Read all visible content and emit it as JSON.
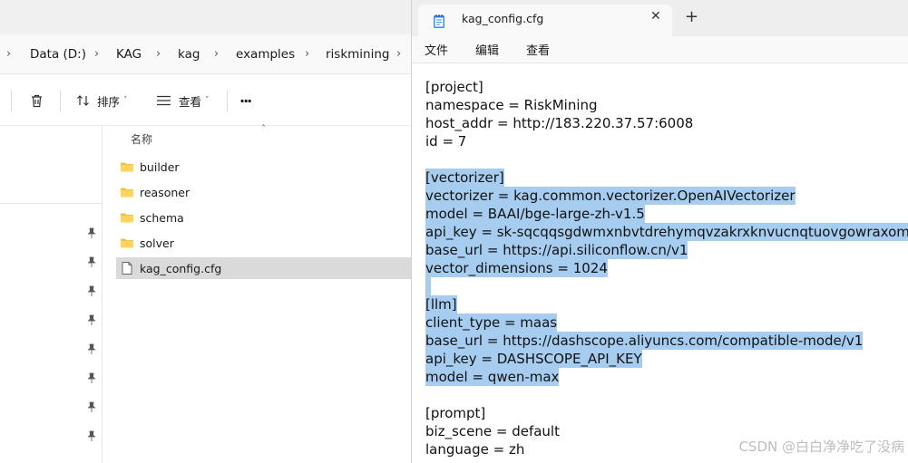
{
  "breadcrumb": {
    "items": [
      {
        "label": "Data (D:)"
      },
      {
        "label": "KAG"
      },
      {
        "label": "kag"
      },
      {
        "label": "examples"
      },
      {
        "label": "riskmining"
      }
    ]
  },
  "toolbar": {
    "sort_label": "排序",
    "view_label": "查看",
    "more_label": "···"
  },
  "filelist": {
    "column_name": "名称",
    "items": [
      {
        "name": "builder",
        "type": "folder"
      },
      {
        "name": "reasoner",
        "type": "folder"
      },
      {
        "name": "schema",
        "type": "folder"
      },
      {
        "name": "solver",
        "type": "folder"
      },
      {
        "name": "kag_config.cfg",
        "type": "file",
        "selected": true
      }
    ]
  },
  "notepad": {
    "tab_title": "kag_config.cfg",
    "menus": [
      "文件",
      "编辑",
      "查看"
    ],
    "lines": [
      "[project]",
      "namespace = RiskMining",
      "host_addr = http://183.220.37.57:6008",
      "id = 7",
      "",
      "[vectorizer]",
      "vectorizer = kag.common.vectorizer.OpenAIVectorizer",
      "model = BAAI/bge-large-zh-v1.5",
      "api_key = sk-sqcqqsgdwmxnbvtdrehymqvzakrxknvucnqtuovgowraxomv",
      "base_url = https://api.siliconflow.cn/v1",
      "vector_dimensions = 1024",
      "",
      "[llm]",
      "client_type = maas",
      "base_url = https://dashscope.aliyuncs.com/compatible-mode/v1",
      "api_key = DASHSCOPE_API_KEY",
      "model = qwen-max",
      "",
      "[prompt]",
      "biz_scene = default",
      "language = zh"
    ]
  },
  "watermark": "CSDN @白白净净吃了没病",
  "colors": {
    "selection": "#a6cdf0",
    "folder": "#f4c040",
    "row_selected": "#dadada"
  }
}
